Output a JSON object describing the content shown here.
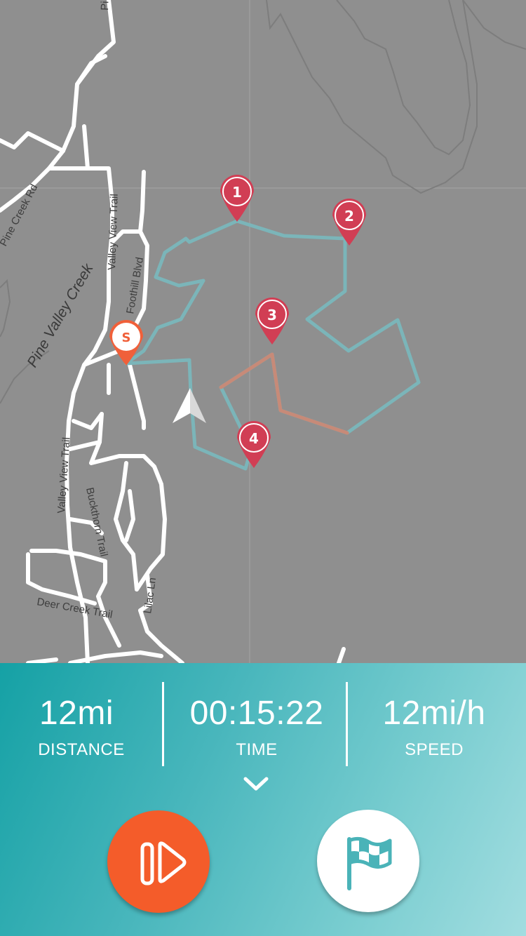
{
  "map": {
    "road_labels": {
      "pine_creek_rd": "Pine Creek Rd",
      "valley_view_trail_top": "Valley View Trail",
      "foothill_blvd": "Foothill Blvd",
      "valley_view_trail_bottom": "Valley View Trail",
      "buckthorn_trail": "Buckthorn Trail",
      "lilac_ln": "Lilac Ln",
      "deer_creek_trail": "Deer Creek Trail",
      "top_partial": "Pi"
    },
    "water_label": "Pine Valley Creek",
    "start_marker": "S",
    "waypoints": [
      "1",
      "2",
      "3",
      "4"
    ],
    "colors": {
      "background": "#8f8f8f",
      "roads": "#ffffff",
      "route": "#7bb5b9",
      "active_route": "#c78a78",
      "waypoint": "#d13e54",
      "start": "#f0603a"
    }
  },
  "stats": {
    "distance": {
      "value": "12mi",
      "label": "DISTANCE"
    },
    "time": {
      "value": "00:15:22",
      "label": "TIME"
    },
    "speed": {
      "value": "12mi/h",
      "label": "SPEED"
    }
  },
  "icons": {
    "collapse": "chevron-down-icon",
    "pause": "pause-play-icon",
    "flag": "flag-icon",
    "location": "navigation-arrow-icon"
  },
  "colors": {
    "panel_start": "#15a1a5",
    "panel_end": "#a2dde0",
    "pause_button": "#f45c2a",
    "flag_button": "#ffffff",
    "flag_icon": "#4ab3b8"
  }
}
